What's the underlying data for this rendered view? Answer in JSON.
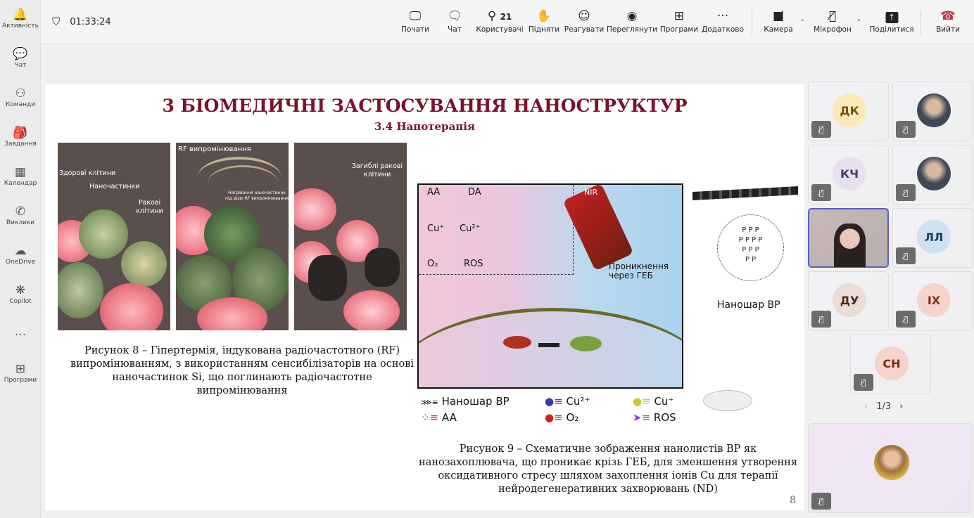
{
  "sidebar": {
    "items": [
      {
        "label": "Активність",
        "icon": "bell-icon",
        "glyph": "🔔"
      },
      {
        "label": "Чат",
        "icon": "chat-icon",
        "glyph": "💬"
      },
      {
        "label": "Команди",
        "icon": "teams-icon",
        "glyph": "⚇"
      },
      {
        "label": "Завдання",
        "icon": "backpack-icon",
        "glyph": "🎒"
      },
      {
        "label": "Календар",
        "icon": "calendar-icon",
        "glyph": "▦"
      },
      {
        "label": "Виклики",
        "icon": "phone-icon",
        "glyph": "✆"
      },
      {
        "label": "OneDrive",
        "icon": "cloud-icon",
        "glyph": "☁"
      },
      {
        "label": "Copilot",
        "icon": "copilot-icon",
        "glyph": "❋"
      },
      {
        "label": "",
        "icon": "more-icon",
        "glyph": "···"
      },
      {
        "label": "Програми",
        "icon": "apps-icon",
        "glyph": "⊞"
      }
    ]
  },
  "meeting": {
    "timer": "01:33:24"
  },
  "toolbar": {
    "share_start": "Почати",
    "chat": "Чат",
    "people": "Користувачі",
    "people_count": "21",
    "raise": "Підняти",
    "react": "Реагувати",
    "view": "Переглянути",
    "apps": "Програми",
    "more": "Додатково",
    "camera": "Камера",
    "mic": "Мікрофон",
    "share": "Поділитися",
    "leave": "Вийти",
    "leave_color": "#c4314b"
  },
  "slide": {
    "title": "3 БІОМЕДИЧНІ ЗАСТОСУВАННЯ НАНОСТРУКТУР",
    "subtitle": "3.4 Напотерапія",
    "fig8": {
      "label_healthy": "Здорові клітини",
      "label_nano": "Наночастинки",
      "label_cancer": "Ракові клітини",
      "label_rf": "RF випромінювання",
      "label_heating": "Нагрівання наночастинок під дією RF випромінювання",
      "label_dead": "Загиблі ракові клітини",
      "caption": "Рисунок 8 – Гіпертермія, індукована радіочастотного (RF) випромінюванням, з використанням сенсибілізаторів на основі наночастинок Si, що поглинають радіочастотне випромінювання"
    },
    "fig9": {
      "aa": "AA",
      "da": "DA",
      "cu1": "Cu⁺",
      "cu2": "Cu²⁺",
      "o2": "O₂",
      "ros": "ROS",
      "nir": "NIR",
      "penetration": "Проникнення через ГЕБ",
      "nanosheet": "Наношар BP",
      "legend": [
        "Наношар BP",
        "Cu²⁺",
        "Cu⁺",
        "AA",
        "O₂",
        "ROS"
      ],
      "caption": "Рисунок 9 – Схематичне зображення нанолистів BP як нанозахоплювача, що проникає крізь ГЕБ, для зменшення утворення оксидативного стресу шляхом захоплення іонів Cu для терапії нейродегенеративних захворювань (ND)"
    },
    "page_number": "8"
  },
  "participants": {
    "tiles": [
      {
        "initials": "ДК",
        "bg": "#fbe9b7",
        "fg": "#6b5a12",
        "muted": true
      },
      {
        "initials": "",
        "photo": true,
        "muted": true
      },
      {
        "initials": "КЧ",
        "bg": "#e6e0f0",
        "fg": "#4b3c6e",
        "muted": true
      },
      {
        "initials": "",
        "photo": true,
        "muted": true
      },
      {
        "initials": "",
        "video": true,
        "muted": false
      },
      {
        "initials": "ЛЛ",
        "bg": "#cfe0f0",
        "fg": "#213e5e",
        "muted": true
      },
      {
        "initials": "ДУ",
        "bg": "#eadcd6",
        "fg": "#4a2e20",
        "muted": true
      },
      {
        "initials": "ІХ",
        "bg": "#f5d4cc",
        "fg": "#7a2a16",
        "muted": true
      },
      {
        "initials": "СН",
        "bg": "#f5d4cc",
        "fg": "#7a2a16",
        "muted": true
      }
    ],
    "page": "1/3"
  }
}
